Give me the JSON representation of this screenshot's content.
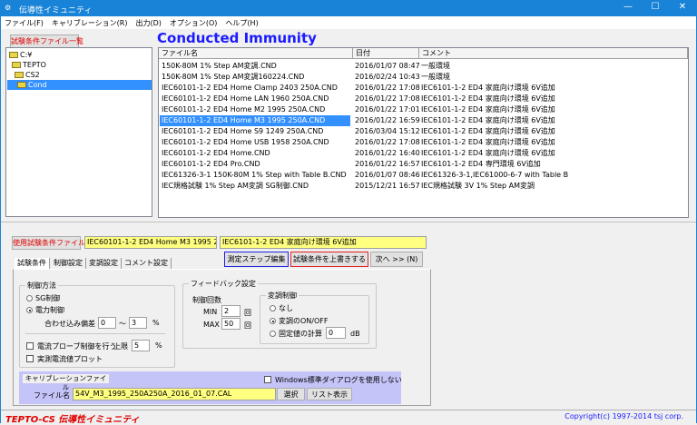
{
  "window": {
    "title": "伝導性イミュニティ",
    "minimize": "—",
    "maximize": "☐",
    "close": "✕"
  },
  "menu": [
    "ファイル(F)",
    "キャリブレーション(R)",
    "出力(D)",
    "オプション(O)",
    "ヘルプ(H)"
  ],
  "file_list_button": "試験条件ファイル一覧",
  "heading": "Conducted Immunity",
  "tree": [
    {
      "label": "C:¥",
      "level": 0
    },
    {
      "label": "TEPTO",
      "level": 1
    },
    {
      "label": "CS2",
      "level": 2
    },
    {
      "label": "Cond",
      "level": 3,
      "selected": true
    }
  ],
  "file_table": {
    "columns": [
      "ファイル名",
      "日付",
      "コメント"
    ],
    "rows": [
      [
        "150K-80M 1% Step AM変調.CND",
        "2016/01/07 08:47",
        "一般環境"
      ],
      [
        "150K-80M 1% Step AM変調160224.CND",
        "2016/02/24 10:43",
        "一般環境"
      ],
      [
        "IEC60101-1-2 ED4 Home Clamp 2403 250A.CND",
        "2016/01/22 17:08",
        "IEC6101-1-2 ED4 家庭向け環境  6V追加"
      ],
      [
        "IEC60101-1-2 ED4 Home LAN 1960 250A.CND",
        "2016/01/22 17:08",
        "IEC6101-1-2 ED4 家庭向け環境  6V追加"
      ],
      [
        "IEC60101-1-2 ED4 Home M2 1995 250A.CND",
        "2016/01/22 17:01",
        "IEC6101-1-2 ED4 家庭向け環境  6V追加"
      ],
      [
        "IEC60101-1-2 ED4 Home M3 1995 250A.CND",
        "2016/01/22 16:59",
        "IEC6101-1-2 ED4 家庭向け環境  6V追加"
      ],
      [
        "IEC60101-1-2 ED4 Home S9 1249 250A.CND",
        "2016/03/04 15:12",
        "IEC6101-1-2 ED4 家庭向け環境  6V追加"
      ],
      [
        "IEC60101-1-2 ED4 Home USB 1958 250A.CND",
        "2016/01/22 17:08",
        "IEC6101-1-2 ED4 家庭向け環境  6V追加"
      ],
      [
        "IEC60101-1-2 ED4 Home.CND",
        "2016/01/22 16:40",
        "IEC6101-1-2 ED4 家庭向け環境  6V追加"
      ],
      [
        "IEC60101-1-2 ED4 Pro.CND",
        "2016/01/22 16:57",
        "IEC6101-1-2 ED4 専門環境  6V追加"
      ],
      [
        "IEC61326-3-1 150K-80M 1% Step  with Table B.CND",
        "2016/01/07 08:46",
        "IEC61326-3-1,IEC61000-6-7 with Table B"
      ],
      [
        "IEC規格試験 1% Step AM変調 SG制御.CND",
        "2015/12/21 16:57",
        "IEC規格試験 3V 1% Step AM変調"
      ]
    ],
    "selected_index": 5
  },
  "current": {
    "button": "使用試験条件ファイル",
    "file": "IEC60101-1-2 ED4 Home M3 1995 250A.CND",
    "comment": "IEC6101-1-2 ED4 家庭向け環境  6V追加"
  },
  "actions": {
    "edit_steps": "測定ステップ編集",
    "overwrite": "試験条件を上書きする",
    "next": "次へ >> (N)"
  },
  "tabs": [
    "試験条件",
    "制御設定",
    "変調設定",
    "コメント設定"
  ],
  "control_method": {
    "title": "制御方法",
    "sg": "SG制御",
    "power": "電力制御",
    "selected": "電力制御",
    "tolerance_label": "合わせ込み偏差",
    "tol_min": "0",
    "tilde": "～",
    "tol_max": "3",
    "pct": "%",
    "probe_label": "電流プローブ制御を行う",
    "probe_checked": false,
    "limit_label": "上限",
    "limit": "5",
    "limit_pct": "%",
    "plot_label": "実測電流値プロット",
    "plot_checked": false
  },
  "feedback": {
    "title": "フィードバック設定",
    "count_label": "制御回数",
    "min_label": "MIN",
    "min": "2",
    "max_label": "MAX",
    "max": "50",
    "unit": "回",
    "mod_title": "変調制御",
    "none": "なし",
    "onoff": "変調のON/OFF",
    "fixed": "固定値の計算",
    "fixed_value": "0",
    "db": "dB",
    "selected": "変調のON/OFF"
  },
  "calibration": {
    "title": "キャリブレーションファイル",
    "no_dialog": "Windows標準ダイアログを使用しない",
    "no_dialog_checked": false,
    "file_label": "ファイル名",
    "file": "54V_M3_1995_250A250A_2016_01_07.CAL",
    "select": "選択",
    "list": "リスト表示"
  },
  "status": {
    "left": "TEPTO-CS 伝導性イミュニティ",
    "right": "Copyright(c) 1997-2014 tsj corp."
  },
  "colors": {
    "titlebar": "#1883d7",
    "heading": "#1a1aff",
    "selection": "#3390ff",
    "highlight_field": "#ffff80",
    "calibration_bg": "#c4c4f8",
    "status_left": "#e00000",
    "status_right": "#1a1aff"
  }
}
